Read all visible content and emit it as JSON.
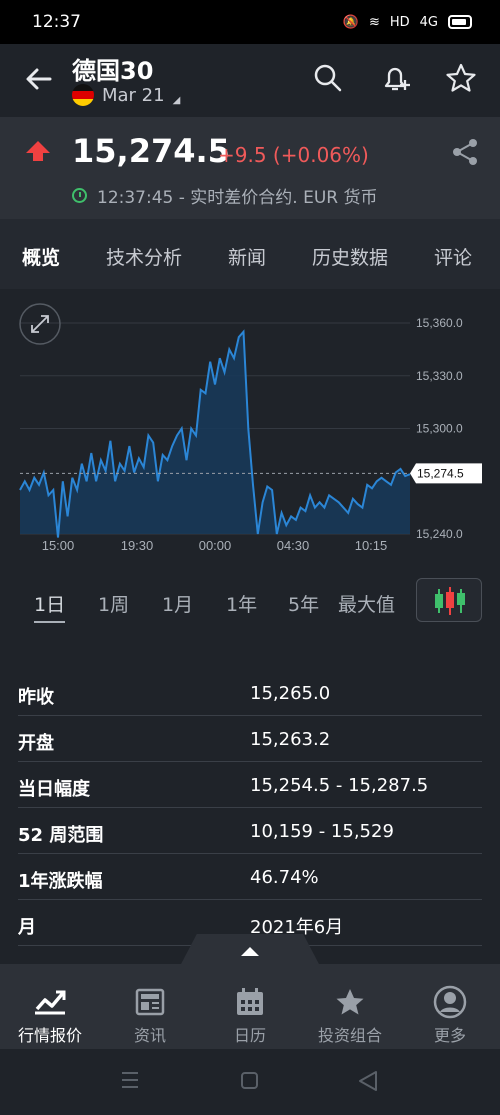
{
  "status": {
    "time": "12:37",
    "network": "HD",
    "signal": "4G"
  },
  "header": {
    "title": "德国30",
    "date": "Mar 21"
  },
  "quote": {
    "price": "15,274.5",
    "change": "+9.5 (+0.06%)",
    "timestamp": "12:37:45 - 实时差价合约. EUR 货币"
  },
  "tabs": [
    "概览",
    "技术分析",
    "新闻",
    "历史数据",
    "评论"
  ],
  "chart_data": {
    "type": "area",
    "x_ticks": [
      "15:00",
      "19:30",
      "00:00",
      "04:30",
      "10:15"
    ],
    "y_ticks": [
      "15,360.0",
      "15,330.0",
      "15,300.0",
      "15,240.0"
    ],
    "current_label": "15,274.5",
    "ylim": [
      15240,
      15360
    ],
    "values": [
      15265,
      15270,
      15265,
      15272,
      15268,
      15275,
      15262,
      15265,
      15238,
      15270,
      15250,
      15272,
      15265,
      15280,
      15270,
      15286,
      15270,
      15282,
      15276,
      15293,
      15270,
      15280,
      15276,
      15290,
      15275,
      15283,
      15278,
      15296,
      15292,
      15270,
      15285,
      15282,
      15290,
      15296,
      15300,
      15282,
      15300,
      15296,
      15322,
      15320,
      15338,
      15325,
      15340,
      15332,
      15345,
      15340,
      15352,
      15355,
      15300,
      15268,
      15240,
      15258,
      15267,
      15265,
      15240,
      15252,
      15245,
      15250,
      15248,
      15255,
      15253,
      15262,
      15255,
      15258,
      15255,
      15262,
      15260,
      15258,
      15255,
      15252,
      15260,
      15257,
      15255,
      15268,
      15266,
      15270,
      15272,
      15270,
      15268,
      15275,
      15277,
      15273,
      15274
    ],
    "colors": {
      "line": "#2b86d6",
      "fill": "#173a5a"
    }
  },
  "ranges": [
    "1日",
    "1周",
    "1月",
    "1年",
    "5年",
    "最大值"
  ],
  "stats": [
    {
      "k": "昨收",
      "v": "15,265.0"
    },
    {
      "k": "开盘",
      "v": "15,263.2"
    },
    {
      "k": "当日幅度",
      "v": "15,254.5 - 15,287.5"
    },
    {
      "k": "52 周范围",
      "v": "10,159 - 15,529"
    },
    {
      "k": "1年涨跌幅",
      "v": "46.74%"
    },
    {
      "k": "月",
      "v": "2021年6月"
    }
  ],
  "nav": [
    {
      "label": "行情报价",
      "icon": "chart-icon"
    },
    {
      "label": "资讯",
      "icon": "news-icon"
    },
    {
      "label": "日历",
      "icon": "calendar-icon"
    },
    {
      "label": "投资组合",
      "icon": "star-icon"
    },
    {
      "label": "更多",
      "icon": "user-icon"
    }
  ],
  "colors": {
    "up": "#f04141",
    "accent": "#2b86d6",
    "bg": "#1f2329"
  }
}
